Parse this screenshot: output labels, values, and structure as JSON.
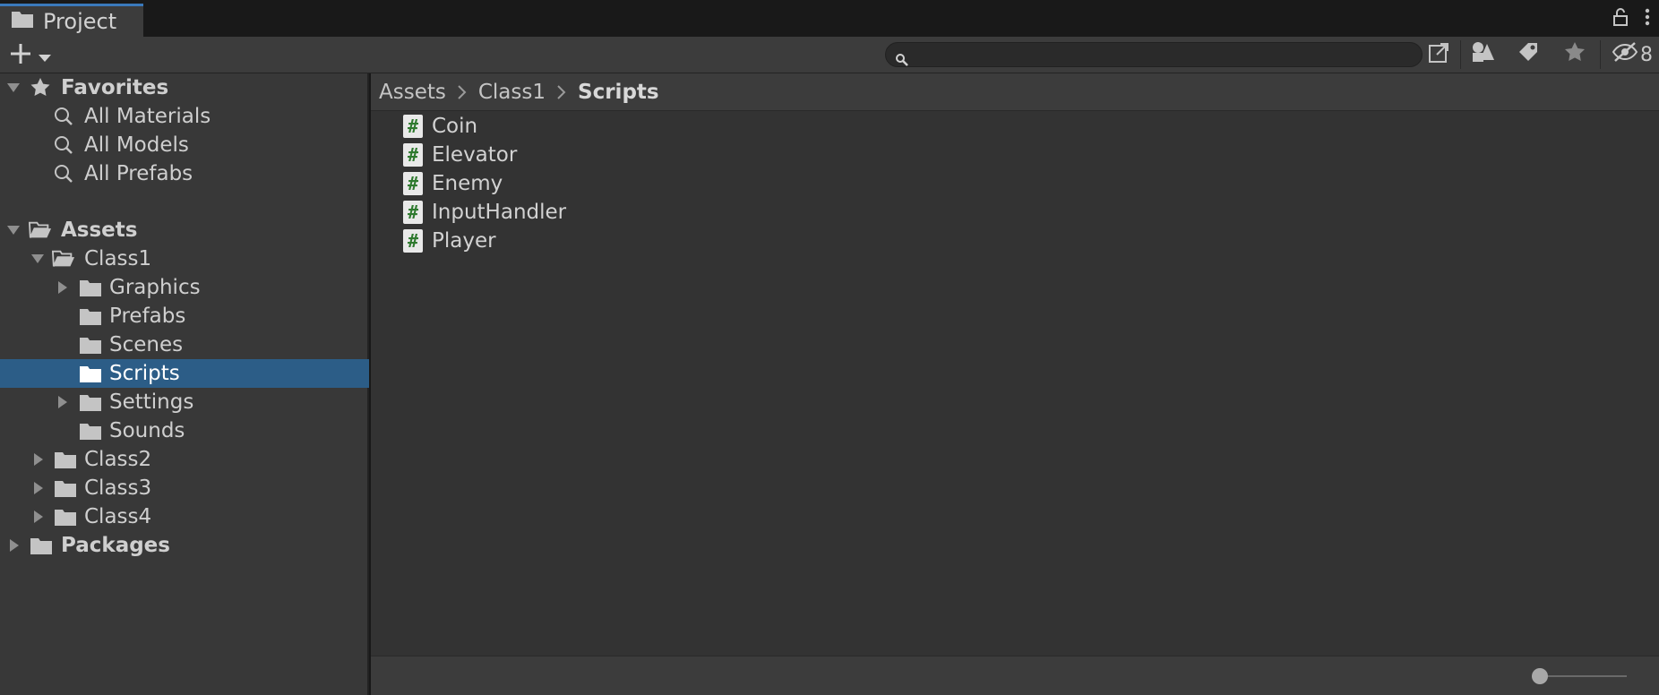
{
  "window": {
    "tab_title": "Project"
  },
  "toolbar": {
    "search_placeholder": "",
    "hidden_count": "8"
  },
  "tree": {
    "favorites_label": "Favorites",
    "favorites": [
      "All Materials",
      "All Models",
      "All Prefabs"
    ],
    "assets_label": "Assets",
    "class1": "Class1",
    "class1_children": [
      "Graphics",
      "Prefabs",
      "Scenes",
      "Scripts",
      "Settings",
      "Sounds"
    ],
    "class2": "Class2",
    "class3": "Class3",
    "class4": "Class4",
    "packages_label": "Packages",
    "selected": "Scripts"
  },
  "breadcrumb": {
    "items": [
      "Assets",
      "Class1",
      "Scripts"
    ]
  },
  "files": [
    "Coin",
    "Elevator",
    "Enemy",
    "InputHandler",
    "Player"
  ],
  "colors": {
    "selection": "#2c5d87",
    "tab_accent": "#3a79bb",
    "panel_bg": "#383838",
    "content_bg": "#333333"
  }
}
